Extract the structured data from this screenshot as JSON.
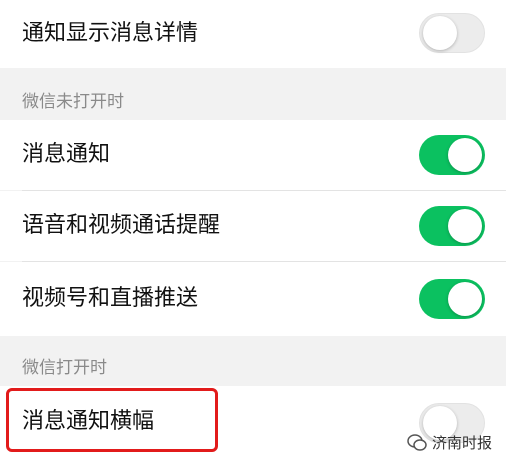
{
  "settings": {
    "row_show_details": {
      "label": "通知显示消息详情",
      "enabled": false
    },
    "section_closed_header": "微信未打开时",
    "row_message_notify": {
      "label": "消息通知",
      "enabled": true
    },
    "row_call_reminder": {
      "label": "语音和视频通话提醒",
      "enabled": true
    },
    "row_channels_live": {
      "label": "视频号和直播推送",
      "enabled": true
    },
    "section_open_header": "微信打开时",
    "row_banner": {
      "label": "消息通知横幅",
      "enabled": false
    }
  },
  "watermark": {
    "text": "济南时报",
    "icon": "wechat-bubble-icon"
  },
  "colors": {
    "toggle_on": "#0bc160",
    "highlight": "#e21b1b"
  }
}
